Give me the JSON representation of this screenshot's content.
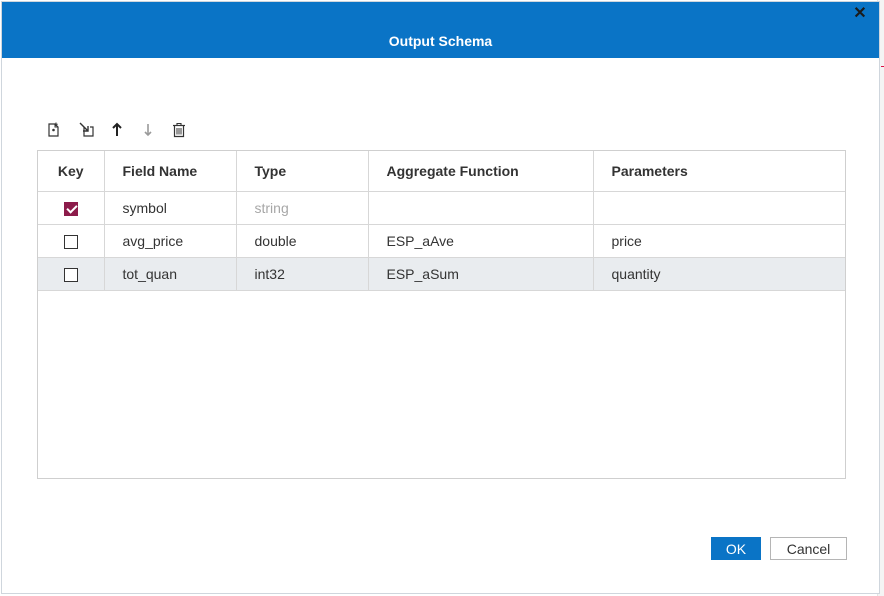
{
  "dialog": {
    "title": "Output Schema",
    "close_glyph": "✕"
  },
  "toolbar": {
    "buttons": [
      {
        "name": "add-field-icon"
      },
      {
        "name": "insert-field-icon"
      },
      {
        "name": "move-up-icon"
      },
      {
        "name": "move-down-icon",
        "disabled": true
      },
      {
        "name": "delete-icon"
      }
    ]
  },
  "grid": {
    "columns": [
      "Key",
      "Field Name",
      "Type",
      "Aggregate Function",
      "Parameters"
    ],
    "rows": [
      {
        "key": true,
        "field_name": "symbol",
        "type": "string",
        "aggregate_function": "",
        "parameters": "",
        "type_muted": true
      },
      {
        "key": false,
        "field_name": "avg_price",
        "type": "double",
        "aggregate_function": "ESP_aAve",
        "parameters": "price"
      },
      {
        "key": false,
        "field_name": "tot_quan",
        "type": "int32",
        "aggregate_function": "ESP_aSum",
        "parameters": "quantity",
        "selected": true
      }
    ]
  },
  "footer": {
    "ok_label": "OK",
    "cancel_label": "Cancel"
  },
  "colors": {
    "titlebar": "#0a74c6",
    "checkbox_checked": "#8c1b4a",
    "selected_row": "#e9ecef"
  }
}
